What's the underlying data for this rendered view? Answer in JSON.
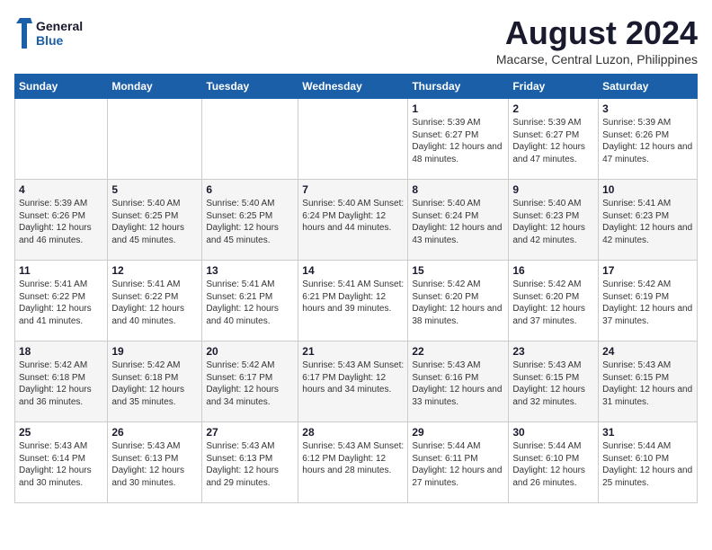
{
  "header": {
    "logo_line1": "General",
    "logo_line2": "Blue",
    "month_year": "August 2024",
    "location": "Macarse, Central Luzon, Philippines"
  },
  "days_of_week": [
    "Sunday",
    "Monday",
    "Tuesday",
    "Wednesday",
    "Thursday",
    "Friday",
    "Saturday"
  ],
  "weeks": [
    [
      {
        "day": "",
        "info": ""
      },
      {
        "day": "",
        "info": ""
      },
      {
        "day": "",
        "info": ""
      },
      {
        "day": "",
        "info": ""
      },
      {
        "day": "1",
        "info": "Sunrise: 5:39 AM\nSunset: 6:27 PM\nDaylight: 12 hours\nand 48 minutes."
      },
      {
        "day": "2",
        "info": "Sunrise: 5:39 AM\nSunset: 6:27 PM\nDaylight: 12 hours\nand 47 minutes."
      },
      {
        "day": "3",
        "info": "Sunrise: 5:39 AM\nSunset: 6:26 PM\nDaylight: 12 hours\nand 47 minutes."
      }
    ],
    [
      {
        "day": "4",
        "info": "Sunrise: 5:39 AM\nSunset: 6:26 PM\nDaylight: 12 hours\nand 46 minutes."
      },
      {
        "day": "5",
        "info": "Sunrise: 5:40 AM\nSunset: 6:25 PM\nDaylight: 12 hours\nand 45 minutes."
      },
      {
        "day": "6",
        "info": "Sunrise: 5:40 AM\nSunset: 6:25 PM\nDaylight: 12 hours\nand 45 minutes."
      },
      {
        "day": "7",
        "info": "Sunrise: 5:40 AM\nSunset: 6:24 PM\nDaylight: 12 hours\nand 44 minutes."
      },
      {
        "day": "8",
        "info": "Sunrise: 5:40 AM\nSunset: 6:24 PM\nDaylight: 12 hours\nand 43 minutes."
      },
      {
        "day": "9",
        "info": "Sunrise: 5:40 AM\nSunset: 6:23 PM\nDaylight: 12 hours\nand 42 minutes."
      },
      {
        "day": "10",
        "info": "Sunrise: 5:41 AM\nSunset: 6:23 PM\nDaylight: 12 hours\nand 42 minutes."
      }
    ],
    [
      {
        "day": "11",
        "info": "Sunrise: 5:41 AM\nSunset: 6:22 PM\nDaylight: 12 hours\nand 41 minutes."
      },
      {
        "day": "12",
        "info": "Sunrise: 5:41 AM\nSunset: 6:22 PM\nDaylight: 12 hours\nand 40 minutes."
      },
      {
        "day": "13",
        "info": "Sunrise: 5:41 AM\nSunset: 6:21 PM\nDaylight: 12 hours\nand 40 minutes."
      },
      {
        "day": "14",
        "info": "Sunrise: 5:41 AM\nSunset: 6:21 PM\nDaylight: 12 hours\nand 39 minutes."
      },
      {
        "day": "15",
        "info": "Sunrise: 5:42 AM\nSunset: 6:20 PM\nDaylight: 12 hours\nand 38 minutes."
      },
      {
        "day": "16",
        "info": "Sunrise: 5:42 AM\nSunset: 6:20 PM\nDaylight: 12 hours\nand 37 minutes."
      },
      {
        "day": "17",
        "info": "Sunrise: 5:42 AM\nSunset: 6:19 PM\nDaylight: 12 hours\nand 37 minutes."
      }
    ],
    [
      {
        "day": "18",
        "info": "Sunrise: 5:42 AM\nSunset: 6:18 PM\nDaylight: 12 hours\nand 36 minutes."
      },
      {
        "day": "19",
        "info": "Sunrise: 5:42 AM\nSunset: 6:18 PM\nDaylight: 12 hours\nand 35 minutes."
      },
      {
        "day": "20",
        "info": "Sunrise: 5:42 AM\nSunset: 6:17 PM\nDaylight: 12 hours\nand 34 minutes."
      },
      {
        "day": "21",
        "info": "Sunrise: 5:43 AM\nSunset: 6:17 PM\nDaylight: 12 hours\nand 34 minutes."
      },
      {
        "day": "22",
        "info": "Sunrise: 5:43 AM\nSunset: 6:16 PM\nDaylight: 12 hours\nand 33 minutes."
      },
      {
        "day": "23",
        "info": "Sunrise: 5:43 AM\nSunset: 6:15 PM\nDaylight: 12 hours\nand 32 minutes."
      },
      {
        "day": "24",
        "info": "Sunrise: 5:43 AM\nSunset: 6:15 PM\nDaylight: 12 hours\nand 31 minutes."
      }
    ],
    [
      {
        "day": "25",
        "info": "Sunrise: 5:43 AM\nSunset: 6:14 PM\nDaylight: 12 hours\nand 30 minutes."
      },
      {
        "day": "26",
        "info": "Sunrise: 5:43 AM\nSunset: 6:13 PM\nDaylight: 12 hours\nand 30 minutes."
      },
      {
        "day": "27",
        "info": "Sunrise: 5:43 AM\nSunset: 6:13 PM\nDaylight: 12 hours\nand 29 minutes."
      },
      {
        "day": "28",
        "info": "Sunrise: 5:43 AM\nSunset: 6:12 PM\nDaylight: 12 hours\nand 28 minutes."
      },
      {
        "day": "29",
        "info": "Sunrise: 5:44 AM\nSunset: 6:11 PM\nDaylight: 12 hours\nand 27 minutes."
      },
      {
        "day": "30",
        "info": "Sunrise: 5:44 AM\nSunset: 6:10 PM\nDaylight: 12 hours\nand 26 minutes."
      },
      {
        "day": "31",
        "info": "Sunrise: 5:44 AM\nSunset: 6:10 PM\nDaylight: 12 hours\nand 25 minutes."
      }
    ]
  ]
}
